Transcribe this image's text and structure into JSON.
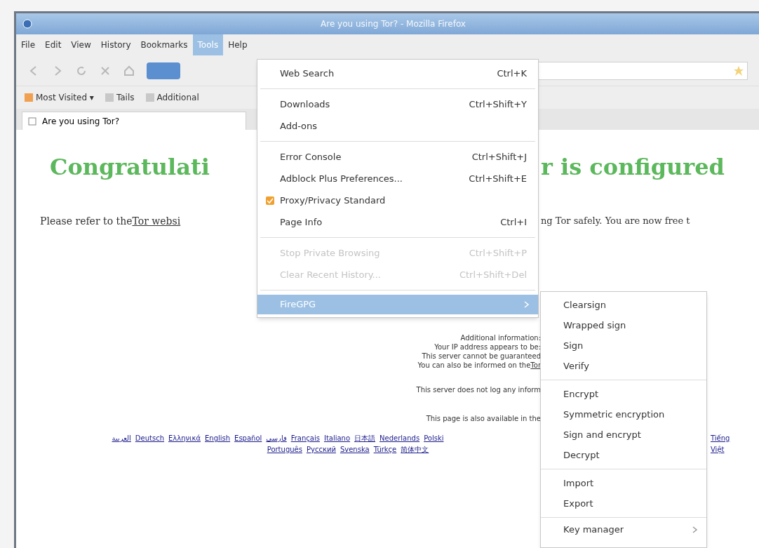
{
  "window": {
    "title": "Are you using Tor? - Mozilla Firefox"
  },
  "menu_bar": [
    {
      "label": "File",
      "selected": false
    },
    {
      "label": "Edit",
      "selected": false
    },
    {
      "label": "View",
      "selected": false
    },
    {
      "label": "History",
      "selected": false
    },
    {
      "label": "Bookmarks",
      "selected": false
    },
    {
      "label": "Tools",
      "selected": true
    },
    {
      "label": "Help",
      "selected": false
    }
  ],
  "bookmarks_bar": [
    "Most Visited ▾",
    "Tails",
    "Additional"
  ],
  "tabs": [
    {
      "label": "Are you using Tor?",
      "selected": true
    }
  ],
  "page": {
    "heading_left": "Congratulati",
    "heading_right": "r is configured",
    "intro_left": "Please refer to the ",
    "intro_link": "Tor websi",
    "intro_right": "ng Tor safely. You are now free t",
    "info_lines": [
      {
        "text": "Additional information:"
      },
      {
        "text": "Your IP address appears to be:"
      },
      {
        "text": "This server cannot be guaranteed"
      },
      {
        "text": "You can also be informed on the ",
        "link": "Tor"
      }
    ],
    "log_line": "This server does not log any inform",
    "languages_line": "This page is also available in the",
    "language_links_left": [
      "العربية",
      "Deutsch",
      "Ελληνικά",
      "English",
      "Español",
      "فارسی",
      "Français",
      "Italiano",
      "日本語",
      "Nederlands",
      "Polski"
    ],
    "language_links_left_2": [
      "Português",
      "Русский",
      "Svenska",
      "Türkçe",
      "简体中文"
    ],
    "language_links_right": [
      "Tiếng",
      "Việt"
    ]
  },
  "tools_menu": [
    {
      "kind": "item",
      "label": "Web Search",
      "shortcut": "Ctrl+K",
      "disabled": false,
      "checked": false
    },
    {
      "kind": "separator"
    },
    {
      "kind": "item",
      "label": "Downloads",
      "shortcut": "Ctrl+Shift+Y",
      "disabled": false,
      "checked": false
    },
    {
      "kind": "item",
      "label": "Add-ons",
      "disabled": false,
      "checked": false
    },
    {
      "kind": "separator"
    },
    {
      "kind": "item",
      "label": "Error Console",
      "shortcut": "Ctrl+Shift+J",
      "disabled": false,
      "checked": false
    },
    {
      "kind": "item",
      "label": "Adblock Plus Preferences...",
      "shortcut": "Ctrl+Shift+E",
      "disabled": false,
      "checked": false
    },
    {
      "kind": "item",
      "label": "Proxy/Privacy Standard",
      "disabled": false,
      "checked": true
    },
    {
      "kind": "item",
      "label": "Page Info",
      "shortcut": "Ctrl+I",
      "disabled": false,
      "checked": false
    },
    {
      "kind": "separator"
    },
    {
      "kind": "item",
      "label": "Stop Private Browsing",
      "shortcut": "Ctrl+Shift+P",
      "disabled": true,
      "checked": false
    },
    {
      "kind": "item",
      "label": "Clear Recent History...",
      "shortcut": "Ctrl+Shift+Del",
      "disabled": true,
      "checked": false
    },
    {
      "kind": "separator"
    },
    {
      "kind": "submenu",
      "label": "FireGPG",
      "selected": true
    }
  ],
  "submenu": [
    {
      "kind": "item",
      "label": "Clearsign"
    },
    {
      "kind": "item",
      "label": "Wrapped sign"
    },
    {
      "kind": "item",
      "label": "Sign"
    },
    {
      "kind": "item",
      "label": "Verify"
    },
    {
      "kind": "separator"
    },
    {
      "kind": "item",
      "label": "Encrypt"
    },
    {
      "kind": "item",
      "label": "Symmetric encryption"
    },
    {
      "kind": "item",
      "label": "Sign and encrypt"
    },
    {
      "kind": "item",
      "label": "Decrypt"
    },
    {
      "kind": "separator"
    },
    {
      "kind": "item",
      "label": "Import"
    },
    {
      "kind": "item",
      "label": "Export"
    },
    {
      "kind": "separator"
    },
    {
      "kind": "submenu",
      "label": "Key manager"
    }
  ]
}
